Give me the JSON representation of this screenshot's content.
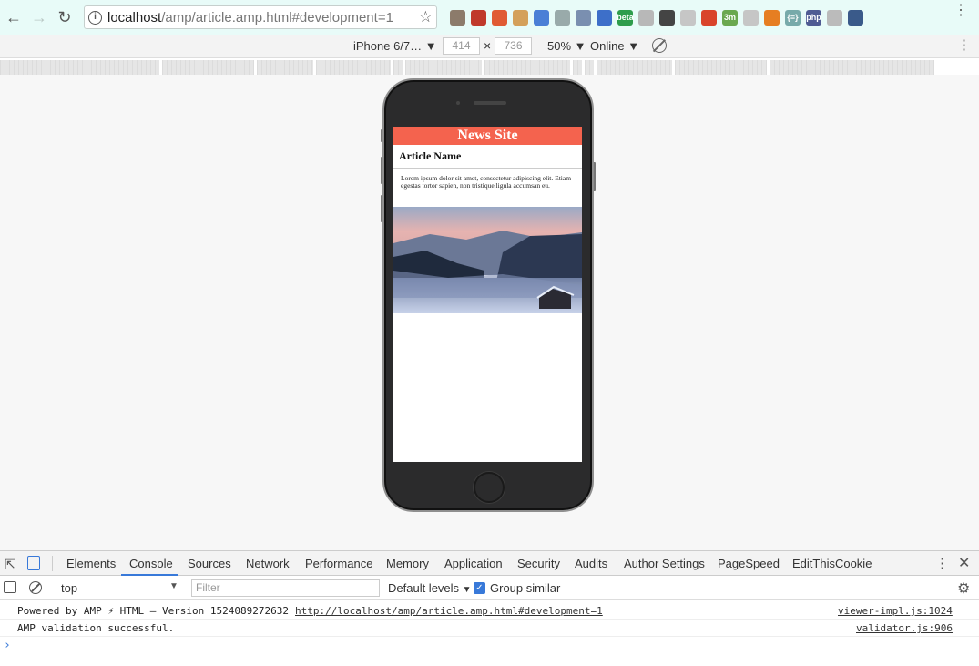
{
  "browser": {
    "url_host": "localhost",
    "url_path": "/amp/article.amp.html#development=1",
    "extensions": [
      {
        "icon": "pawprint-icon",
        "color": "#8c7b6b",
        "label": ""
      },
      {
        "icon": "mail-icon",
        "color": "#c0392b",
        "label": ""
      },
      {
        "icon": "stop-icon",
        "color": "#e05a33",
        "label": ""
      },
      {
        "icon": "cookie-icon",
        "color": "#d4a05a",
        "label": ""
      },
      {
        "icon": "translate-icon",
        "color": "#4a7fd6",
        "label": ""
      },
      {
        "icon": "recycle-icon",
        "color": "#9aa",
        "label": ""
      },
      {
        "icon": "bird-icon",
        "color": "#7a8fb0",
        "label": ""
      },
      {
        "icon": "flag-icon",
        "color": "#3d6fc9",
        "label": ""
      },
      {
        "icon": "beta-icon",
        "color": "#2e9d4c",
        "label": "beta"
      },
      {
        "icon": "window-icon",
        "color": "#b8b8b8",
        "label": ""
      },
      {
        "icon": "code-icon",
        "color": "#444",
        "label": ""
      },
      {
        "icon": "frame-icon",
        "color": "#c6c6c6",
        "label": ""
      },
      {
        "icon": "play-icon",
        "color": "#d9442b",
        "label": ""
      },
      {
        "icon": "timer-icon",
        "color": "#6aa84f",
        "label": "3m"
      },
      {
        "icon": "picture-icon",
        "color": "#c6c6c6",
        "label": ""
      },
      {
        "icon": "rss-icon",
        "color": "#e67e22",
        "label": ""
      },
      {
        "icon": "json-icon",
        "color": "#7aa",
        "label": "{≡}"
      },
      {
        "icon": "php-icon",
        "color": "#4f5b93",
        "label": "php"
      },
      {
        "icon": "circle-icon",
        "color": "#bbbbbb",
        "label": ""
      },
      {
        "icon": "bookmark-icon",
        "color": "#3a5a8a",
        "label": ""
      }
    ]
  },
  "device_toolbar": {
    "device": "iPhone 6/7…",
    "width": "414",
    "height": "736",
    "zoom": "50%",
    "network": "Online"
  },
  "page": {
    "site_title": "News Site",
    "article_title": "Article Name",
    "article_body": "Lorem ipsum dolor sit amet, consectetur adipiscing elit. Etiam egestas tortor sapien, non tristique ligula accumsan eu."
  },
  "devtools": {
    "tabs": [
      "Elements",
      "Console",
      "Sources",
      "Network",
      "Performance",
      "Memory",
      "Application",
      "Security",
      "Audits",
      "Author Settings",
      "PageSpeed",
      "EditThisCookie"
    ],
    "active_tab": "Console",
    "context": "top",
    "filter_placeholder": "Filter",
    "levels": "Default levels",
    "group_similar": "Group similar",
    "logs": [
      {
        "message": "Powered by AMP ⚡ HTML – Version 1524089272632",
        "link": "http://localhost/amp/article.amp.html#development=1",
        "source": "viewer-impl.js:1024"
      },
      {
        "message": "AMP validation successful.",
        "link": "",
        "source": "validator.js:906"
      }
    ],
    "prompt": "›"
  }
}
